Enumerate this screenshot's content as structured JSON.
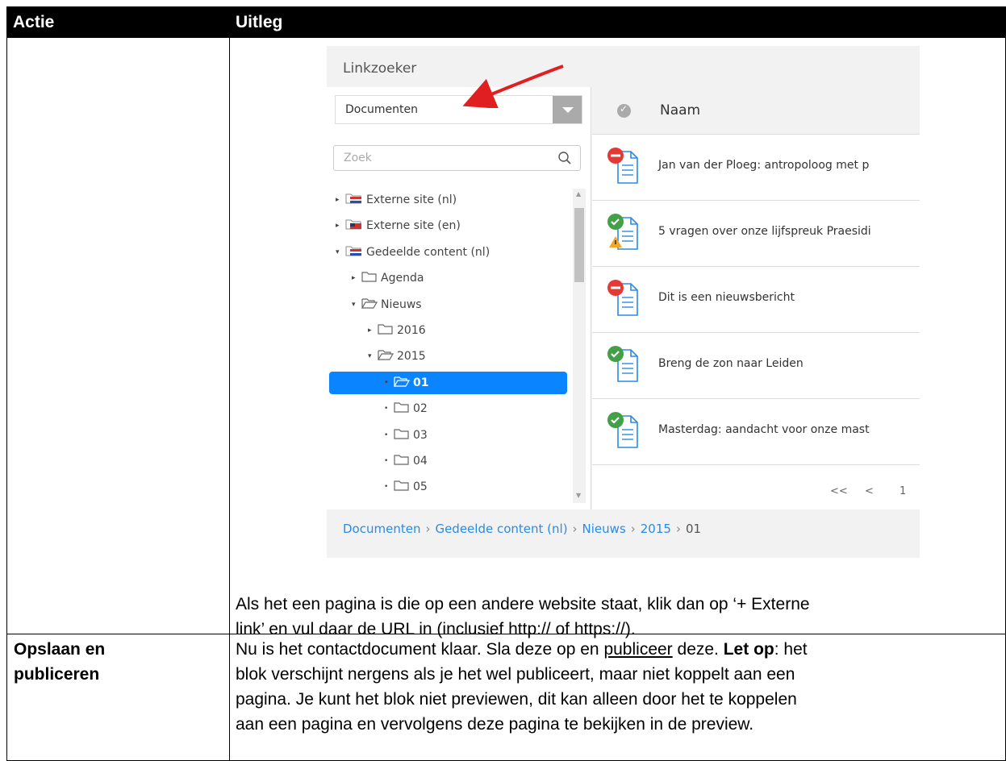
{
  "header": {
    "col1": "Actie",
    "col2": "Uitleg"
  },
  "linkzoeker": {
    "title": "Linkzoeker",
    "dropdown_value": "Documenten",
    "search_placeholder": "Zoek",
    "tree": [
      {
        "label": "Externe site (nl)",
        "toggle": "▸",
        "icon": "nl-flag-folder-icon"
      },
      {
        "label": "Externe site (en)",
        "toggle": "▸",
        "icon": "us-flag-folder-icon"
      },
      {
        "label": "Gedeelde content (nl)",
        "toggle": "▾",
        "icon": "nl-flag-open-folder-icon"
      },
      {
        "label": "Agenda",
        "toggle": "▸",
        "icon": "folder-icon"
      },
      {
        "label": "Nieuws",
        "toggle": "▾",
        "icon": "open-folder-icon"
      },
      {
        "label": "2016",
        "toggle": "▸",
        "icon": "folder-icon"
      },
      {
        "label": "2015",
        "toggle": "▾",
        "icon": "open-folder-icon"
      },
      {
        "label": "01",
        "toggle": "•",
        "icon": "open-folder-icon",
        "selected": true
      },
      {
        "label": "02",
        "toggle": "•",
        "icon": "folder-icon"
      },
      {
        "label": "03",
        "toggle": "•",
        "icon": "folder-icon"
      },
      {
        "label": "04",
        "toggle": "•",
        "icon": "folder-icon"
      },
      {
        "label": "05",
        "toggle": "•",
        "icon": "folder-icon"
      }
    ],
    "column_header": "Naam",
    "documents": [
      {
        "name": "Jan van der Ploeg: antropoloog met p",
        "status": "unpublished"
      },
      {
        "name": "5 vragen over onze lijfspreuk Praesidi",
        "status": "published-warning"
      },
      {
        "name": "Dit is een nieuwsbericht",
        "status": "unpublished"
      },
      {
        "name": "Breng de zon naar Leiden",
        "status": "published"
      },
      {
        "name": "Masterdag: aandacht voor onze mast",
        "status": "published"
      }
    ],
    "pager": {
      "first": "<<",
      "prev": "<",
      "page": "1"
    },
    "breadcrumb": [
      "Documenten",
      "Gedeelde content (nl)",
      "Nieuws",
      "2015",
      "01"
    ]
  },
  "row1_text_line1": "Als het een pagina is die op een andere website staat, klik dan op ‘+ Externe",
  "row1_text_line2": "link’ en vul daar de URL in (inclusief http:// of https://).",
  "row2": {
    "action_line1": "Opslaan en",
    "action_line2": "publiceren",
    "t1a": "Nu is het contactdocument klaar. Sla deze op en ",
    "t1u": "publiceer",
    "t1b": " deze. ",
    "t1bold": "Let op",
    "t1c": ": het",
    "line2": "blok verschijnt nergens als je het wel publiceert, maar niet koppelt aan een",
    "line3": "pagina. Je kunt het blok niet previewen, dit kan alleen door het te koppelen",
    "line4": "aan een pagina en vervolgens deze pagina te bekijken in de preview."
  },
  "colors": {
    "selected": "#0a84ff",
    "link": "#2a8be6",
    "arrow": "#e02020"
  }
}
